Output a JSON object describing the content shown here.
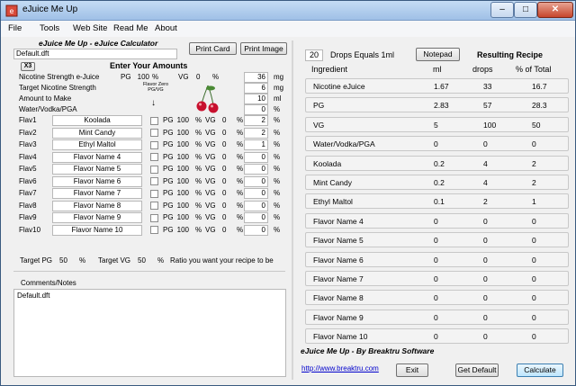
{
  "window": {
    "title": "eJuice Me Up"
  },
  "menu": [
    "File",
    "Tools",
    "Web Site",
    "Read Me",
    "About"
  ],
  "file_field": "Default.dft",
  "app_heading": "eJuice Me Up - eJuice Calculator",
  "buttons": {
    "print_card": "Print Card",
    "print_image": "Print Image",
    "notepad": "Notepad",
    "exit": "Exit",
    "get_default": "Get Default",
    "calculate": "Calculate"
  },
  "multiplier": "X3",
  "enter_amounts": "Enter Your Amounts",
  "flavor_zero_label": "Flavor Zero PG/VG",
  "nicotine": {
    "label": "Nicotine Strength e-Juice",
    "pg_label": "PG",
    "pg_value": "100",
    "pct": "%",
    "vg_label": "VG",
    "vg_value": "0",
    "strength": "36",
    "unit": "mg"
  },
  "target_nic": {
    "label": "Target Nicotine Strength",
    "value": "6",
    "unit": "mg"
  },
  "amount": {
    "label": "Amount to Make",
    "value": "10",
    "unit": "ml"
  },
  "water": {
    "label": "Water/Vodka/PGA",
    "value": "0",
    "unit": "%"
  },
  "flavors": [
    {
      "id": "Flav1",
      "name": "Koolada",
      "pg_label": "PG",
      "pg": "100",
      "pct1": "%",
      "vg_label": "VG",
      "vg": "0",
      "pct2": "%",
      "amount": "2",
      "pct3": "%"
    },
    {
      "id": "Flav2",
      "name": "Mint Candy",
      "pg_label": "PG",
      "pg": "100",
      "pct1": "%",
      "vg_label": "VG",
      "vg": "0",
      "pct2": "%",
      "amount": "2",
      "pct3": "%"
    },
    {
      "id": "Flav3",
      "name": "Ethyl Maltol",
      "pg_label": "PG",
      "pg": "100",
      "pct1": "%",
      "vg_label": "VG",
      "vg": "0",
      "pct2": "%",
      "amount": "1",
      "pct3": "%"
    },
    {
      "id": "Flav4",
      "name": "Flavor Name 4",
      "pg_label": "PG",
      "pg": "100",
      "pct1": "%",
      "vg_label": "VG",
      "vg": "0",
      "pct2": "%",
      "amount": "0",
      "pct3": "%"
    },
    {
      "id": "Flav5",
      "name": "Flavor Name 5",
      "pg_label": "PG",
      "pg": "100",
      "pct1": "%",
      "vg_label": "VG",
      "vg": "0",
      "pct2": "%",
      "amount": "0",
      "pct3": "%"
    },
    {
      "id": "Flav6",
      "name": "Flavor Name 6",
      "pg_label": "PG",
      "pg": "100",
      "pct1": "%",
      "vg_label": "VG",
      "vg": "0",
      "pct2": "%",
      "amount": "0",
      "pct3": "%"
    },
    {
      "id": "Flav7",
      "name": "Flavor Name 7",
      "pg_label": "PG",
      "pg": "100",
      "pct1": "%",
      "vg_label": "VG",
      "vg": "0",
      "pct2": "%",
      "amount": "0",
      "pct3": "%"
    },
    {
      "id": "Flav8",
      "name": "Flavor Name 8",
      "pg_label": "PG",
      "pg": "100",
      "pct1": "%",
      "vg_label": "VG",
      "vg": "0",
      "pct2": "%",
      "amount": "0",
      "pct3": "%"
    },
    {
      "id": "Flav9",
      "name": "Flavor Name 9",
      "pg_label": "PG",
      "pg": "100",
      "pct1": "%",
      "vg_label": "VG",
      "vg": "0",
      "pct2": "%",
      "amount": "0",
      "pct3": "%"
    },
    {
      "id": "Flav10",
      "name": "Flavor Name 10",
      "pg_label": "PG",
      "pg": "100",
      "pct1": "%",
      "vg_label": "VG",
      "vg": "0",
      "pct2": "%",
      "amount": "0",
      "pct3": "%"
    }
  ],
  "target_ratio": {
    "pg_label": "Target PG",
    "pg": "50",
    "pg_pct": "%",
    "vg_label": "Target VG",
    "vg": "50",
    "vg_pct": "%",
    "hint": "Ratio you want your recipe to be"
  },
  "comments": {
    "label": "Comments/Notes",
    "text": "Default.dft"
  },
  "drops": {
    "value": "20",
    "label": "Drops Equals 1ml"
  },
  "recipe": {
    "heading": "Resulting Recipe",
    "columns": [
      "Ingredient",
      "ml",
      "drops",
      "% of Total"
    ],
    "rows": [
      [
        "Nicotine eJuice",
        "1.67",
        "33",
        "16.7"
      ],
      [
        "PG",
        "2.83",
        "57",
        "28.3"
      ],
      [
        "VG",
        "5",
        "100",
        "50"
      ],
      [
        "Water/Vodka/PGA",
        "0",
        "0",
        "0"
      ],
      [
        "Koolada",
        "0.2",
        "4",
        "2"
      ],
      [
        "Mint Candy",
        "0.2",
        "4",
        "2"
      ],
      [
        "Ethyl Maltol",
        "0.1",
        "2",
        "1"
      ],
      [
        "Flavor Name 4",
        "0",
        "0",
        "0"
      ],
      [
        "Flavor Name 5",
        "0",
        "0",
        "0"
      ],
      [
        "Flavor Name 6",
        "0",
        "0",
        "0"
      ],
      [
        "Flavor Name 7",
        "0",
        "0",
        "0"
      ],
      [
        "Flavor Name 8",
        "0",
        "0",
        "0"
      ],
      [
        "Flavor Name 9",
        "0",
        "0",
        "0"
      ],
      [
        "Flavor Name 10",
        "0",
        "0",
        "0"
      ]
    ]
  },
  "footer": {
    "brand": "eJuice Me Up  -  By Breaktru Software",
    "link": "http://www.breaktru.com"
  },
  "colors": {
    "titlebar": "#9fc0e6",
    "close": "#c6452c",
    "link": "#0000cc",
    "cherry": "#c8102e"
  }
}
